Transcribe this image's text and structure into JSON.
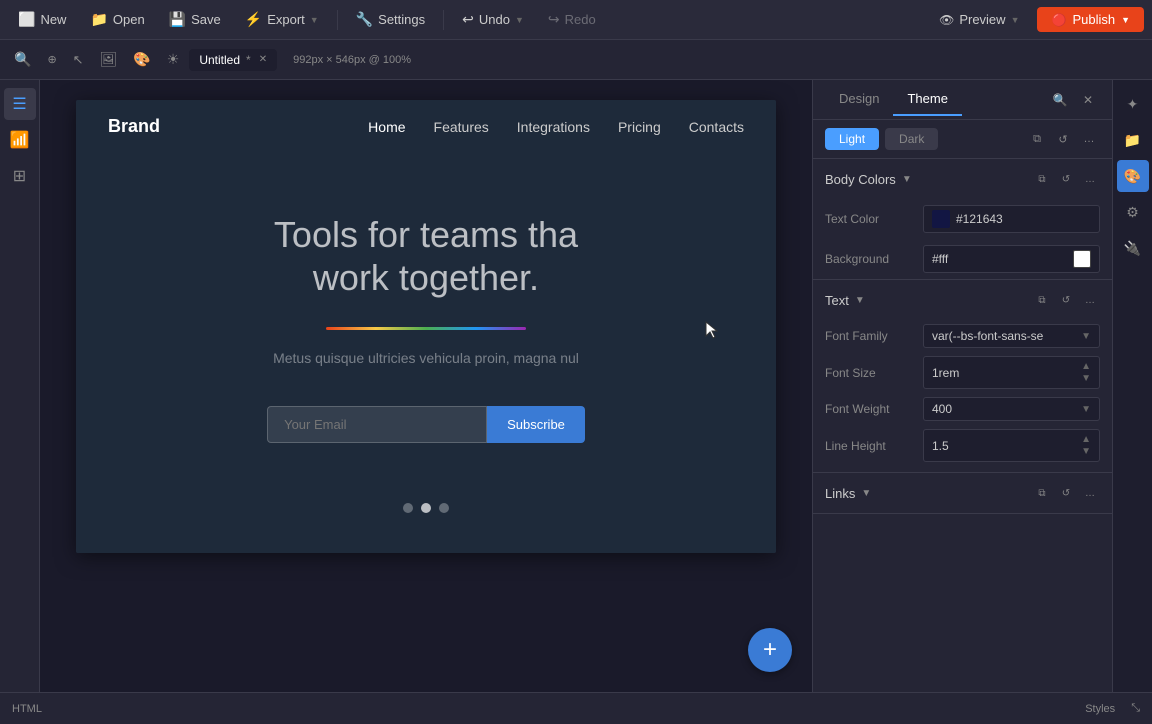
{
  "topbar": {
    "items": [
      {
        "id": "new",
        "label": "New",
        "icon": "⬜"
      },
      {
        "id": "open",
        "label": "Open",
        "icon": "📁"
      },
      {
        "id": "save",
        "label": "Save",
        "icon": "💾"
      },
      {
        "id": "export",
        "label": "Export",
        "icon": "⚡"
      },
      {
        "id": "settings",
        "label": "Settings",
        "icon": "🔧"
      },
      {
        "id": "undo",
        "label": "Undo",
        "icon": "↩"
      },
      {
        "id": "redo",
        "label": "Redo",
        "icon": "↪",
        "disabled": true
      }
    ],
    "publish_label": "Publish"
  },
  "tab": {
    "name": "Untitled",
    "modified": true
  },
  "canvas": {
    "zoom": "992px × 546px @ 100%"
  },
  "site": {
    "brand": "Brand",
    "nav_links": [
      "Home",
      "Features",
      "Integrations",
      "Pricing",
      "Contacts"
    ],
    "nav_active": "Home",
    "hero_title_line1": "Tools for teams tha",
    "hero_title_line2": "work together.",
    "hero_subtitle": "Metus quisque ultricies vehicula proin, magna nul",
    "email_placeholder": "Your Email",
    "subscribe_label": "Subscribe"
  },
  "right_panel": {
    "tabs": [
      "Design",
      "Theme"
    ],
    "active_tab": "Theme",
    "theme_buttons": [
      "Light",
      "Dark"
    ],
    "active_theme": "Light",
    "body_colors_label": "Body Colors",
    "text_color_label": "Text Color",
    "text_color_value": "#121643",
    "background_label": "Background",
    "background_value": "#fff",
    "text_section_label": "Text",
    "font_family_label": "Font Family",
    "font_family_value": "var(--bs-font-sans-se",
    "font_size_label": "Font Size",
    "font_size_value": "1rem",
    "font_weight_label": "Font Weight",
    "font_weight_value": "400",
    "line_height_label": "Line Height",
    "line_height_value": "1.5",
    "links_section_label": "Links"
  }
}
